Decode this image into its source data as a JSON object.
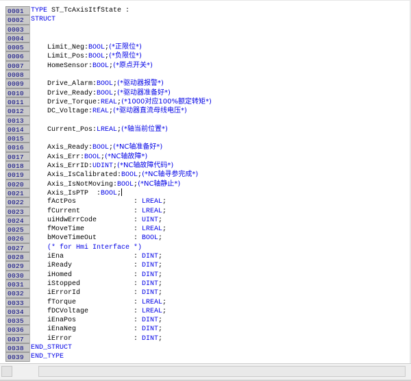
{
  "editor": {
    "lines": [
      {
        "num": "0001",
        "segs": [
          {
            "t": "TYPE",
            "c": "kw"
          },
          {
            "t": " ST_TcAxisItfState :",
            "c": "tx"
          }
        ]
      },
      {
        "num": "0002",
        "segs": [
          {
            "t": "STRUCT",
            "c": "kw"
          }
        ]
      },
      {
        "num": "0003",
        "segs": []
      },
      {
        "num": "0004",
        "segs": []
      },
      {
        "num": "0005",
        "segs": [
          {
            "t": "    Limit_Neg:",
            "c": "tx"
          },
          {
            "t": "BOOL",
            "c": "kw"
          },
          {
            "t": ";",
            "c": "tx"
          },
          {
            "t": "(*正限位*)",
            "c": "cm"
          }
        ]
      },
      {
        "num": "0006",
        "segs": [
          {
            "t": "    Limit_Pos:",
            "c": "tx"
          },
          {
            "t": "BOOL",
            "c": "kw"
          },
          {
            "t": ";",
            "c": "tx"
          },
          {
            "t": "(*负限位*)",
            "c": "cm"
          }
        ]
      },
      {
        "num": "0007",
        "segs": [
          {
            "t": "    HomeSensor:",
            "c": "tx"
          },
          {
            "t": "BOOL",
            "c": "kw"
          },
          {
            "t": ";",
            "c": "tx"
          },
          {
            "t": "(*原点开关*)",
            "c": "cm"
          }
        ]
      },
      {
        "num": "0008",
        "segs": []
      },
      {
        "num": "0009",
        "segs": [
          {
            "t": "    Drive_Alarm:",
            "c": "tx"
          },
          {
            "t": "BOOL",
            "c": "kw"
          },
          {
            "t": ";",
            "c": "tx"
          },
          {
            "t": "(*驱动器报警*)",
            "c": "cm"
          }
        ]
      },
      {
        "num": "0010",
        "segs": [
          {
            "t": "    Drive_Ready:",
            "c": "tx"
          },
          {
            "t": "BOOL",
            "c": "kw"
          },
          {
            "t": ";",
            "c": "tx"
          },
          {
            "t": "(*驱动器准备好*)",
            "c": "cm"
          }
        ]
      },
      {
        "num": "0011",
        "segs": [
          {
            "t": "    Drive_Torque:",
            "c": "tx"
          },
          {
            "t": "REAL",
            "c": "kw"
          },
          {
            "t": ";",
            "c": "tx"
          },
          {
            "t": "(*1000对应100%额定转矩*)",
            "c": "cm"
          }
        ]
      },
      {
        "num": "0012",
        "segs": [
          {
            "t": "    DC_Voltage:",
            "c": "tx"
          },
          {
            "t": "REAL",
            "c": "kw"
          },
          {
            "t": ";",
            "c": "tx"
          },
          {
            "t": "(*驱动器直流母线电压*)",
            "c": "cm"
          }
        ]
      },
      {
        "num": "0013",
        "segs": []
      },
      {
        "num": "0014",
        "segs": [
          {
            "t": "    Current_Pos:",
            "c": "tx"
          },
          {
            "t": "LREAL",
            "c": "kw"
          },
          {
            "t": ";",
            "c": "tx"
          },
          {
            "t": "(*轴当前位置*)",
            "c": "cm"
          }
        ]
      },
      {
        "num": "0015",
        "segs": []
      },
      {
        "num": "0016",
        "segs": [
          {
            "t": "    Axis_Ready:",
            "c": "tx"
          },
          {
            "t": "BOOL",
            "c": "kw"
          },
          {
            "t": ";",
            "c": "tx"
          },
          {
            "t": "(*NC轴准备好*)",
            "c": "cm"
          }
        ]
      },
      {
        "num": "0017",
        "segs": [
          {
            "t": "    Axis_Err:",
            "c": "tx"
          },
          {
            "t": "BOOL",
            "c": "kw"
          },
          {
            "t": ";",
            "c": "tx"
          },
          {
            "t": "(*NC轴故障*)",
            "c": "cm"
          }
        ]
      },
      {
        "num": "0018",
        "segs": [
          {
            "t": "    Axis_ErrID:",
            "c": "tx"
          },
          {
            "t": "UDINT",
            "c": "kw"
          },
          {
            "t": ";",
            "c": "tx"
          },
          {
            "t": "(*NC轴故障代码*)",
            "c": "cm"
          }
        ]
      },
      {
        "num": "0019",
        "segs": [
          {
            "t": "    Axis_IsCalibrated:",
            "c": "tx"
          },
          {
            "t": "BOOL",
            "c": "kw"
          },
          {
            "t": ";",
            "c": "tx"
          },
          {
            "t": "(*NC轴寻参完成*)",
            "c": "cm"
          }
        ]
      },
      {
        "num": "0020",
        "segs": [
          {
            "t": "    Axis_IsNotMoving:",
            "c": "tx"
          },
          {
            "t": "BOOL",
            "c": "kw"
          },
          {
            "t": ";",
            "c": "tx"
          },
          {
            "t": "(*NC轴静止*)",
            "c": "cm"
          }
        ]
      },
      {
        "num": "0021",
        "segs": [
          {
            "t": "    Axis_IsPTP  :",
            "c": "tx"
          },
          {
            "t": "BOOL",
            "c": "kw"
          },
          {
            "t": ";",
            "c": "tx"
          },
          {
            "t": "",
            "c": "cursor"
          }
        ]
      },
      {
        "num": "0022",
        "segs": [
          {
            "t": "    fActPos              : ",
            "c": "tx"
          },
          {
            "t": "LREAL",
            "c": "kw"
          },
          {
            "t": ";",
            "c": "tx"
          }
        ]
      },
      {
        "num": "0023",
        "segs": [
          {
            "t": "    fCurrent             : ",
            "c": "tx"
          },
          {
            "t": "LREAL",
            "c": "kw"
          },
          {
            "t": ";",
            "c": "tx"
          }
        ]
      },
      {
        "num": "0024",
        "segs": [
          {
            "t": "    uiHdwErrCode         : ",
            "c": "tx"
          },
          {
            "t": "UINT",
            "c": "kw"
          },
          {
            "t": ";",
            "c": "tx"
          }
        ]
      },
      {
        "num": "0025",
        "segs": [
          {
            "t": "    fMoveTime            : ",
            "c": "tx"
          },
          {
            "t": "LREAL",
            "c": "kw"
          },
          {
            "t": ";",
            "c": "tx"
          }
        ]
      },
      {
        "num": "0026",
        "segs": [
          {
            "t": "    bMoveTimeOut         : ",
            "c": "tx"
          },
          {
            "t": "BOOL",
            "c": "kw"
          },
          {
            "t": ";",
            "c": "tx"
          }
        ]
      },
      {
        "num": "0027",
        "segs": [
          {
            "t": "    (* for Hmi Interface *)",
            "c": "cm"
          }
        ]
      },
      {
        "num": "0028",
        "segs": [
          {
            "t": "    iEna                 : ",
            "c": "tx"
          },
          {
            "t": "DINT",
            "c": "kw"
          },
          {
            "t": ";",
            "c": "tx"
          }
        ]
      },
      {
        "num": "0029",
        "segs": [
          {
            "t": "    iReady               : ",
            "c": "tx"
          },
          {
            "t": "DINT",
            "c": "kw"
          },
          {
            "t": ";",
            "c": "tx"
          }
        ]
      },
      {
        "num": "0030",
        "segs": [
          {
            "t": "    iHomed               : ",
            "c": "tx"
          },
          {
            "t": "DINT",
            "c": "kw"
          },
          {
            "t": ";",
            "c": "tx"
          }
        ]
      },
      {
        "num": "0031",
        "segs": [
          {
            "t": "    iStopped             : ",
            "c": "tx"
          },
          {
            "t": "DINT",
            "c": "kw"
          },
          {
            "t": ";",
            "c": "tx"
          }
        ]
      },
      {
        "num": "0032",
        "segs": [
          {
            "t": "    iErrorId             : ",
            "c": "tx"
          },
          {
            "t": "DINT",
            "c": "kw"
          },
          {
            "t": ";",
            "c": "tx"
          }
        ]
      },
      {
        "num": "0033",
        "segs": [
          {
            "t": "    fTorque              : ",
            "c": "tx"
          },
          {
            "t": "LREAL",
            "c": "kw"
          },
          {
            "t": ";",
            "c": "tx"
          }
        ]
      },
      {
        "num": "0034",
        "segs": [
          {
            "t": "    fDCVoltage           : ",
            "c": "tx"
          },
          {
            "t": "LREAL",
            "c": "kw"
          },
          {
            "t": ";",
            "c": "tx"
          }
        ]
      },
      {
        "num": "0035",
        "segs": [
          {
            "t": "    iEnaPos              : ",
            "c": "tx"
          },
          {
            "t": "DINT",
            "c": "kw"
          },
          {
            "t": ";",
            "c": "tx"
          }
        ]
      },
      {
        "num": "0036",
        "segs": [
          {
            "t": "    iEnaNeg              : ",
            "c": "tx"
          },
          {
            "t": "DINT",
            "c": "kw"
          },
          {
            "t": ";",
            "c": "tx"
          }
        ]
      },
      {
        "num": "0037",
        "segs": [
          {
            "t": "    iError               : ",
            "c": "tx"
          },
          {
            "t": "DINT",
            "c": "kw"
          },
          {
            "t": ";",
            "c": "tx"
          }
        ]
      },
      {
        "num": "0038",
        "segs": [
          {
            "t": "END_STRUCT",
            "c": "kw"
          }
        ]
      },
      {
        "num": "0039",
        "segs": [
          {
            "t": "END_TYPE",
            "c": "kw"
          }
        ]
      }
    ]
  },
  "colors": {
    "keyword": "#0000e6",
    "comment": "#0000e6",
    "text": "#000000",
    "gutter_bg": "#c9c9c9",
    "gutter_text": "#000080"
  }
}
